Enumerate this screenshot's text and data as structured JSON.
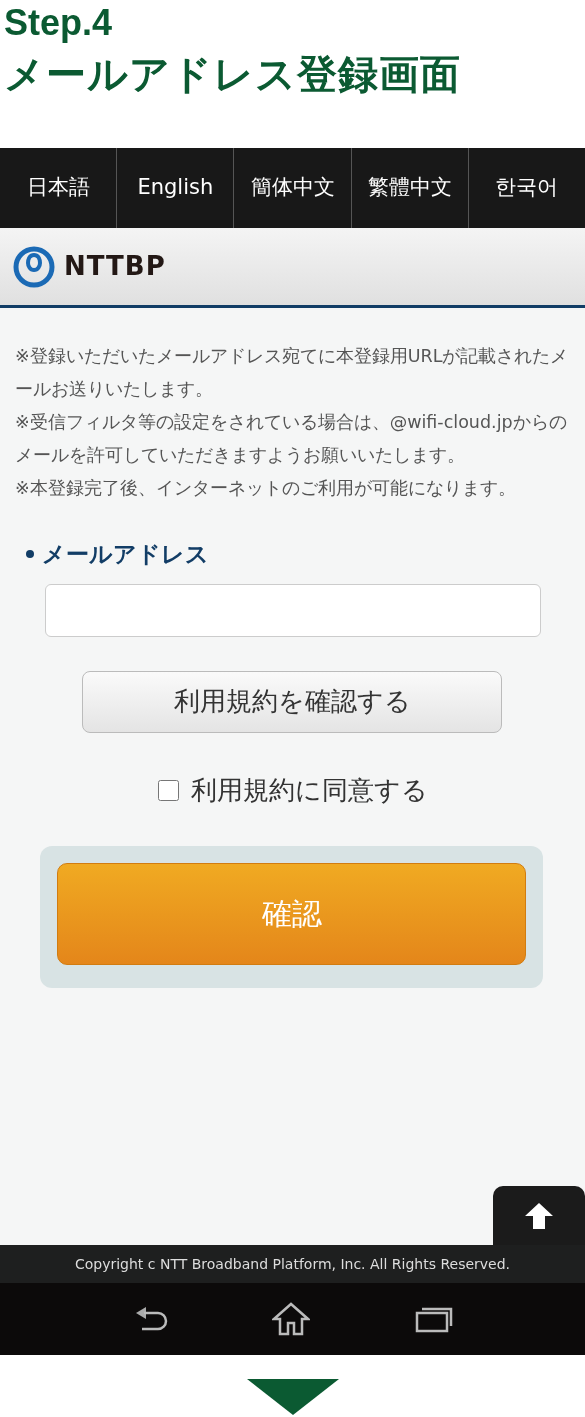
{
  "heading": {
    "step": "Step.4",
    "title": "メールアドレス登録画面"
  },
  "languages": [
    {
      "label": "日本語"
    },
    {
      "label": "English"
    },
    {
      "label": "簡体中文"
    },
    {
      "label": "繁體中文"
    },
    {
      "label": "한국어"
    }
  ],
  "logo": {
    "text": "NTTBP"
  },
  "notes": [
    "※登録いただいたメールアドレス宛てに本登録用URLが記載されたメールお送りいたします。",
    "※受信フィルタ等の設定をされている場合は、@wifi-cloud.jpからのメールを許可していただきますようお願いいたします。",
    "※本登録完了後、インターネットのご利用が可能になります。"
  ],
  "email": {
    "label": "メールアドレス"
  },
  "terms_button": "利用規約を確認する",
  "agree": {
    "label": "利用規約に同意する",
    "checked": false
  },
  "confirm_button": "確認",
  "footer": "Copyright c NTT Broadband Platform, Inc. All Rights Reserved."
}
